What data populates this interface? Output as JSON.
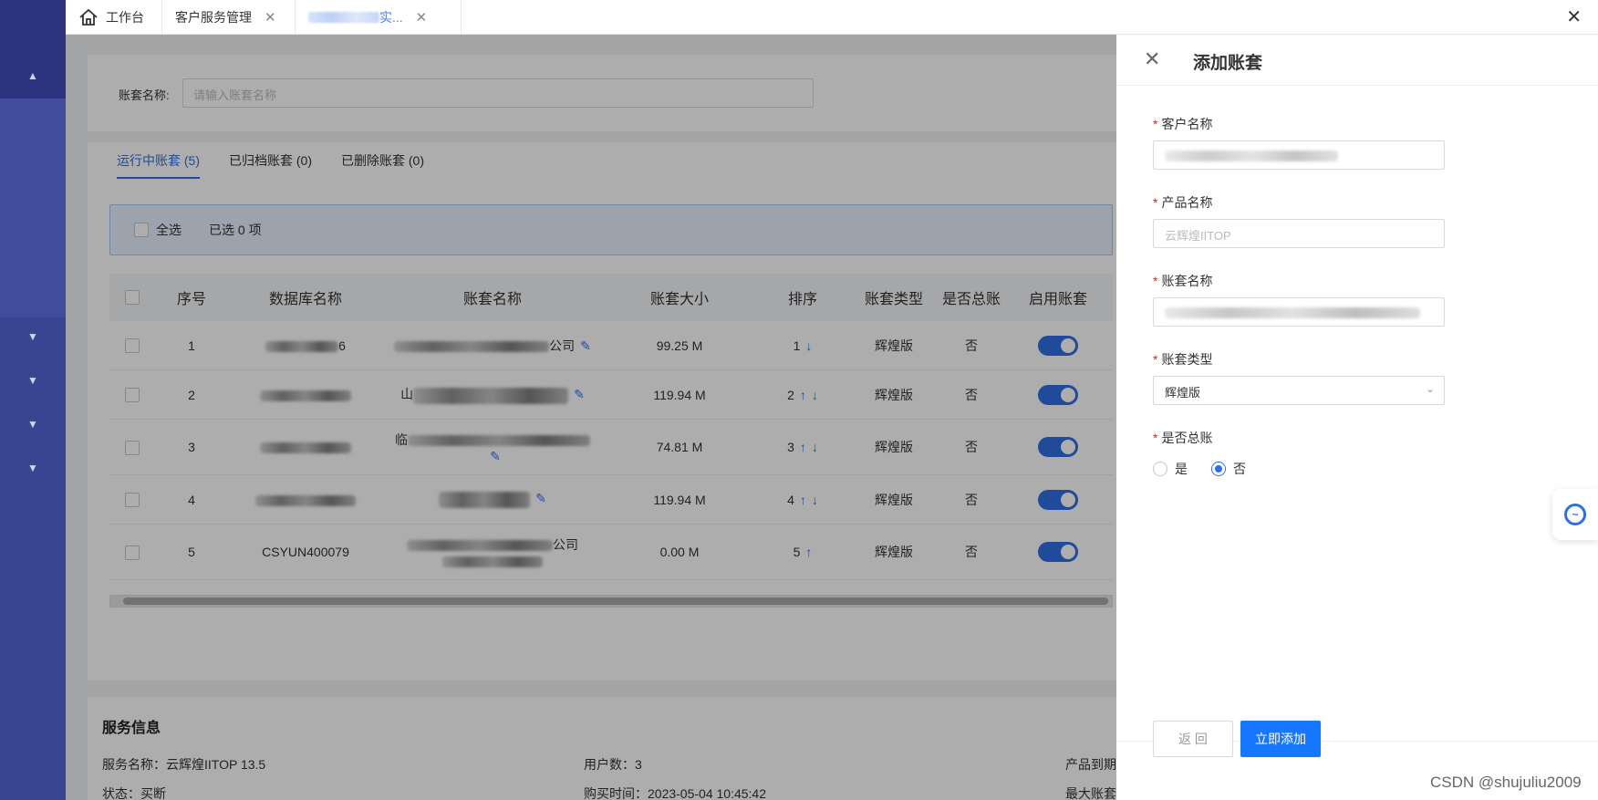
{
  "nav": {
    "chevrons": [
      "▲",
      "▼",
      "▼",
      "▼",
      "▼"
    ]
  },
  "tabbar": {
    "home_label": "工作台",
    "tab2_label": "客户服务管理",
    "tab3_suffix": "实...",
    "close_glyph": "✕"
  },
  "search": {
    "label": "账套名称:",
    "placeholder": "请输入账套名称"
  },
  "tabs": [
    {
      "label": "运行中账套 (5)"
    },
    {
      "label": "已归档账套 (0)"
    },
    {
      "label": "已删除账套 (0)"
    }
  ],
  "selection": {
    "select_all": "全选",
    "selected_text": "已选 0 项"
  },
  "table": {
    "headers": [
      "序号",
      "数据库名称",
      "账套名称",
      "账套大小",
      "排序",
      "账套类型",
      "是否总账",
      "启用账套"
    ],
    "rows": [
      {
        "index": "1",
        "db": "6",
        "name_suffix": "公司",
        "size": "99.25 M",
        "order": "1",
        "type": "辉煌版",
        "is_general": "否"
      },
      {
        "index": "2",
        "db": "",
        "name_prefix": "山",
        "size": "119.94 M",
        "order": "2",
        "type": "辉煌版",
        "is_general": "否"
      },
      {
        "index": "3",
        "db": "",
        "name_prefix": "临",
        "size": "74.81 M",
        "order": "3",
        "type": "辉煌版",
        "is_general": "否"
      },
      {
        "index": "4",
        "db": "",
        "size": "119.94 M",
        "order": "4",
        "type": "辉煌版",
        "is_general": "否"
      },
      {
        "index": "5",
        "db": "CSYUN400079",
        "name_suffix": "公司",
        "size": "0.00 M",
        "order": "5",
        "type": "辉煌版",
        "is_general": "否"
      }
    ]
  },
  "service": {
    "title": "服务信息",
    "name_line": "服务名称：云辉煌IITOP 13.5",
    "status_line": "状态：买断",
    "users_line": "用户数：3",
    "purchase_line": "购买时间：2023-05-04 10:45:42",
    "expire_line": "产品到期",
    "max_line": "最大账套"
  },
  "drawer": {
    "title": "添加账套",
    "fields": {
      "customer_label": "客户名称",
      "product_label": "产品名称",
      "product_placeholder": "云辉煌IITOP",
      "account_label": "账套名称",
      "type_label": "账套类型",
      "type_value": "辉煌版",
      "general_label": "是否总账",
      "yes_label": "是",
      "no_label": "否"
    },
    "back_label": "返 回",
    "add_label": "立即添加"
  },
  "watermark": "CSDN @shujuliu2009"
}
